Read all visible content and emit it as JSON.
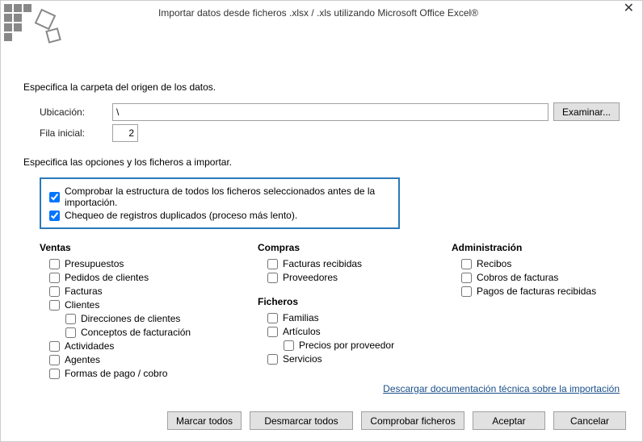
{
  "window": {
    "title": "Importar datos desde ficheros .xlsx / .xls utilizando Microsoft Office Excel®"
  },
  "labels": {
    "specify_folder": "Especifica la carpeta del origen de los datos.",
    "location_label": "Ubicación:",
    "location_value": "\\",
    "browse": "Examinar...",
    "startrow_label": "Fila inicial:",
    "startrow_value": "2",
    "specify_options": "Especifica las opciones y los ficheros a importar."
  },
  "options": {
    "check_structure": {
      "label": "Comprobar la estructura de todos los ficheros seleccionados antes de la importación.",
      "checked": true
    },
    "check_duplicates": {
      "label": "Chequeo de registros duplicados (proceso más lento).",
      "checked": true
    }
  },
  "groups": {
    "ventas": {
      "title": "Ventas",
      "items": {
        "presupuestos": "Presupuestos",
        "pedidos_clientes": "Pedidos de clientes",
        "facturas": "Facturas",
        "clientes": "Clientes",
        "direcciones_clientes": "Direcciones de clientes",
        "conceptos_facturacion": "Conceptos de facturación",
        "actividades": "Actividades",
        "agentes": "Agentes",
        "formas_pago": "Formas de pago / cobro"
      }
    },
    "compras": {
      "title": "Compras",
      "items": {
        "facturas_recibidas": "Facturas recibidas",
        "proveedores": "Proveedores"
      }
    },
    "ficheros": {
      "title": "Ficheros",
      "items": {
        "familias": "Familias",
        "articulos": "Artículos",
        "precios_proveedor": "Precios por proveedor",
        "servicios": "Servicios"
      }
    },
    "administracion": {
      "title": "Administración",
      "items": {
        "recibos": "Recibos",
        "cobros_facturas": "Cobros de facturas",
        "pagos_facturas_recibidas": "Pagos de facturas recibidas"
      }
    }
  },
  "link": {
    "doc_text": "Descargar documentación técnica sobre la importación"
  },
  "buttons": {
    "mark_all": "Marcar todos",
    "unmark_all": "Desmarcar todos",
    "check_files": "Comprobar ficheros",
    "accept": "Aceptar",
    "cancel": "Cancelar"
  }
}
